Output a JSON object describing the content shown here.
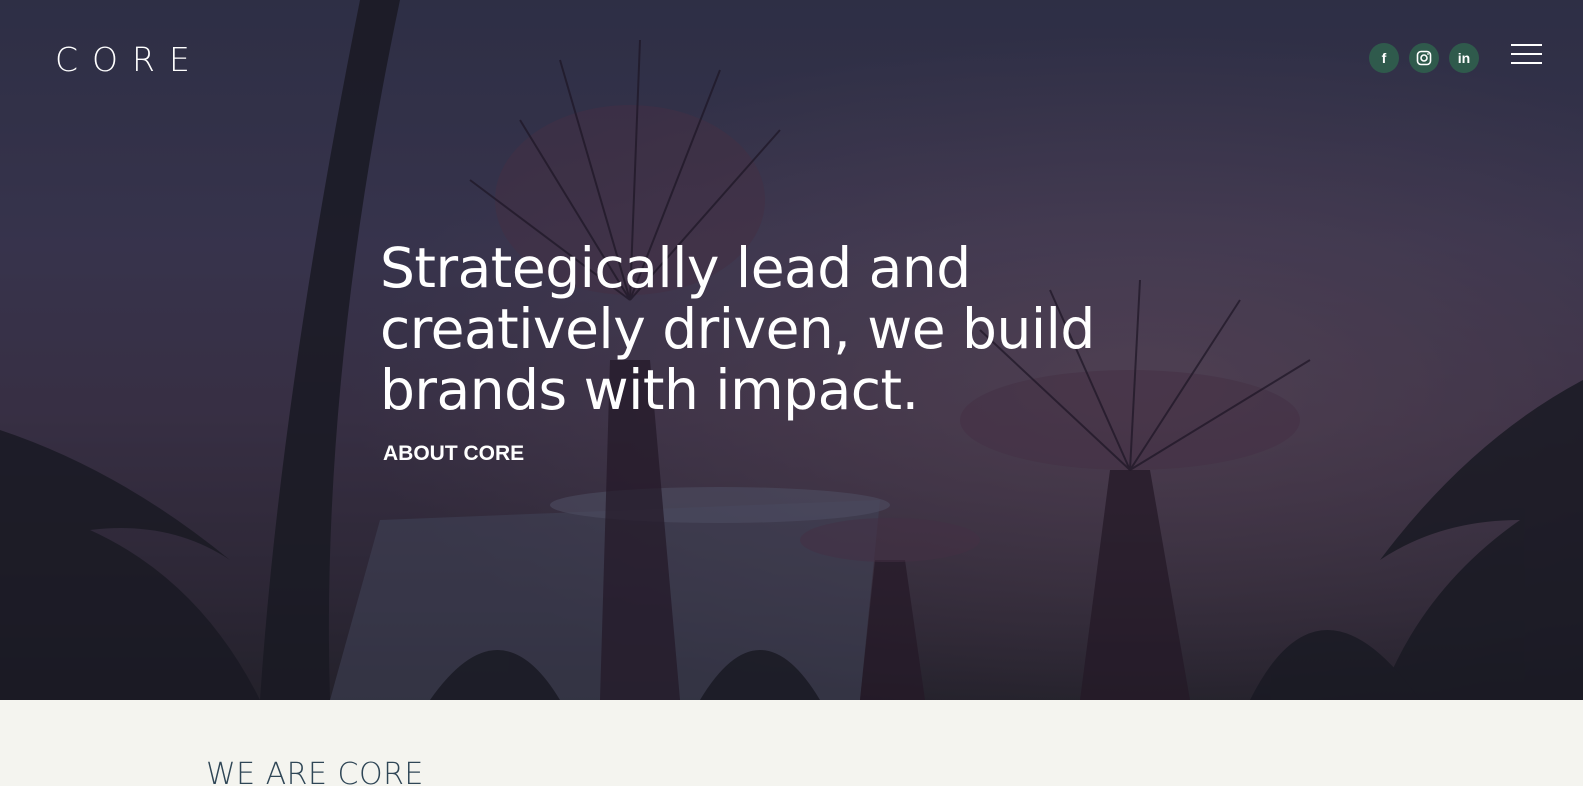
{
  "header": {
    "logo_text": "CORE",
    "social": [
      {
        "name": "facebook",
        "label": "f",
        "icon": "facebook-icon"
      },
      {
        "name": "instagram",
        "label": "",
        "icon": "instagram-icon"
      },
      {
        "name": "linkedin",
        "label": "in",
        "icon": "linkedin-icon"
      }
    ],
    "menu_icon": "hamburger-menu-icon"
  },
  "hero": {
    "headline": "Strategically lead and creatively driven, we build brands with impact.",
    "cta_label": "ABOUT CORE"
  },
  "section": {
    "heading": "WE ARE CORE"
  },
  "colors": {
    "social_bg": "#2f5a4c",
    "section_bg": "#f4f4ef",
    "section_heading": "#2f4656",
    "text_light": "#ffffff"
  }
}
